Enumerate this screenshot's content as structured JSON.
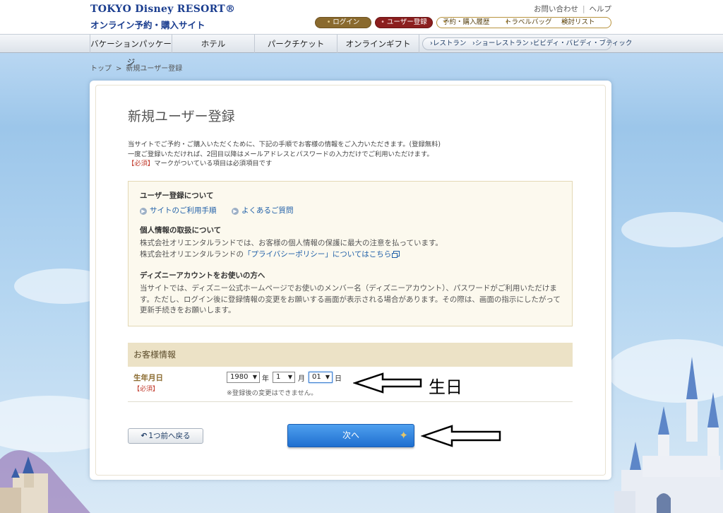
{
  "header": {
    "logo_line1": "TOKYO Disney RESORT®",
    "logo_line2": "オンライン予約・購入サイト",
    "contact_link": "お問い合わせ",
    "help_link": "ヘルプ",
    "login_label": "ログイン",
    "register_label": "ユーザー登録",
    "history_label": "予約・購入履歴",
    "bag_label": "トラベルバッグ",
    "list_label": "検討リスト"
  },
  "nav": {
    "items": [
      {
        "label": "バケーションパッケージ"
      },
      {
        "label": "ホテル"
      },
      {
        "label": "パークチケット"
      },
      {
        "label": "オンラインギフト"
      }
    ],
    "sub_items": [
      {
        "label": "レストラン"
      },
      {
        "label": "ショーレストラン"
      },
      {
        "label": "ビビディ・バビディ・ブティック"
      }
    ]
  },
  "breadcrumb": {
    "home": "トップ",
    "sep": ">",
    "current": "新規ユーザー登録"
  },
  "page": {
    "title": "新規ユーザー登録",
    "intro_line1": "当サイトでご予約・ご購入いただくために、下記の手順でお客様の情報をご入力いただきます。(登録無料)",
    "intro_line2": "一度ご登録いただければ、2回目以降はメールアドレスとパスワードの入力だけでご利用いただけます。",
    "intro_req_mark": "【必須】",
    "intro_line3": "マークがついている項目は必須項目です"
  },
  "infobox": {
    "about_heading": "ユーザー登録について",
    "link_usage": "サイトのご利用手順",
    "link_faq": "よくあるご質問",
    "privacy_heading": "個人情報の取扱について",
    "privacy_line1": "株式会社オリエンタルランドでは、お客様の個人情報の保護に最大の注意を払っています。",
    "privacy_line2_prefix": "株式会社オリエンタルランドの",
    "privacy_link": "「プライバシーポリシー」についてはこちら",
    "account_heading": "ディズニーアカウントをお使いの方へ",
    "account_text": "当サイトでは、ディズニー公式ホームページでお使いのメンバー名（ディズニーアカウント）、パスワードがご利用いただけます。ただし、ログイン後に登録情報の変更をお願いする画面が表示される場合があります。その際は、画面の指示にしたがって更新手続きをお願いします。"
  },
  "form": {
    "section_title": "お客様情報",
    "birth_label": "生年月日",
    "required_mark": "【必須】",
    "year_value": "1980",
    "year_unit": "年",
    "month_value": "1",
    "month_unit": "月",
    "day_value": "01",
    "day_unit": "日",
    "note": "※登録後の変更はできません。"
  },
  "annotation": {
    "text": "生日"
  },
  "buttons": {
    "back_label": "1つ前へ戻る",
    "next_label": "次へ"
  }
}
